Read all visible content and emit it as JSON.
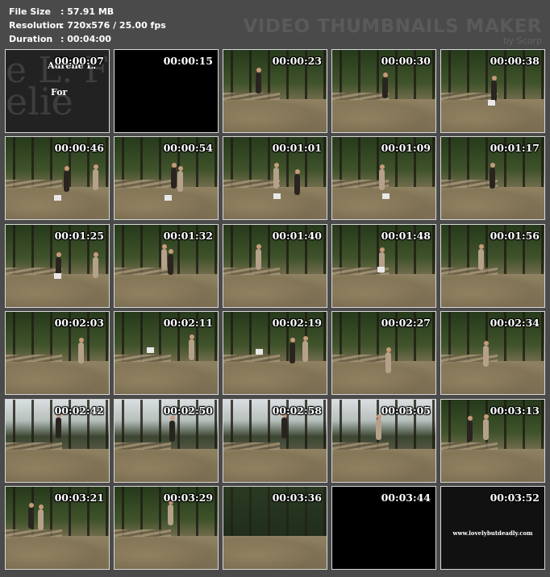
{
  "info": {
    "file_size_label": "File Size",
    "file_size_value": ": 57.91 MB",
    "resolution_label": "Resolution",
    "resolution_value": ": 720x576 / 25.00 fps",
    "duration_label": "Duration",
    "duration_value": ": 00:04:00"
  },
  "brand": {
    "title": "VIDEO THUMBNAILS MAKER",
    "subtitle": "by Scorp"
  },
  "title_card": {
    "big_line1": "e L. F",
    "big_line2": "elie",
    "name": "Aurelie L.",
    "for": "For"
  },
  "end_card": {
    "url": "www.lovelybutdeadly.com"
  },
  "thumbnails": [
    {
      "time": "00:00:07",
      "kind": "title"
    },
    {
      "time": "00:00:15",
      "kind": "black"
    },
    {
      "time": "00:00:23",
      "kind": "forest"
    },
    {
      "time": "00:00:30",
      "kind": "forest"
    },
    {
      "time": "00:00:38",
      "kind": "forest"
    },
    {
      "time": "00:00:46",
      "kind": "forest"
    },
    {
      "time": "00:00:54",
      "kind": "forest"
    },
    {
      "time": "00:01:01",
      "kind": "forest"
    },
    {
      "time": "00:01:09",
      "kind": "forest"
    },
    {
      "time": "00:01:17",
      "kind": "forest"
    },
    {
      "time": "00:01:25",
      "kind": "forest"
    },
    {
      "time": "00:01:32",
      "kind": "forest"
    },
    {
      "time": "00:01:40",
      "kind": "forest"
    },
    {
      "time": "00:01:48",
      "kind": "forest"
    },
    {
      "time": "00:01:56",
      "kind": "forest"
    },
    {
      "time": "00:02:03",
      "kind": "forest"
    },
    {
      "time": "00:02:11",
      "kind": "forest"
    },
    {
      "time": "00:02:19",
      "kind": "forest"
    },
    {
      "time": "00:02:27",
      "kind": "forest"
    },
    {
      "time": "00:02:34",
      "kind": "forest"
    },
    {
      "time": "00:02:42",
      "kind": "sky"
    },
    {
      "time": "00:02:50",
      "kind": "sky"
    },
    {
      "time": "00:02:58",
      "kind": "sky"
    },
    {
      "time": "00:03:05",
      "kind": "sky"
    },
    {
      "time": "00:03:13",
      "kind": "forest"
    },
    {
      "time": "00:03:21",
      "kind": "forest"
    },
    {
      "time": "00:03:29",
      "kind": "forest"
    },
    {
      "time": "00:03:36",
      "kind": "night"
    },
    {
      "time": "00:03:44",
      "kind": "black"
    },
    {
      "time": "00:03:52",
      "kind": "end"
    }
  ]
}
